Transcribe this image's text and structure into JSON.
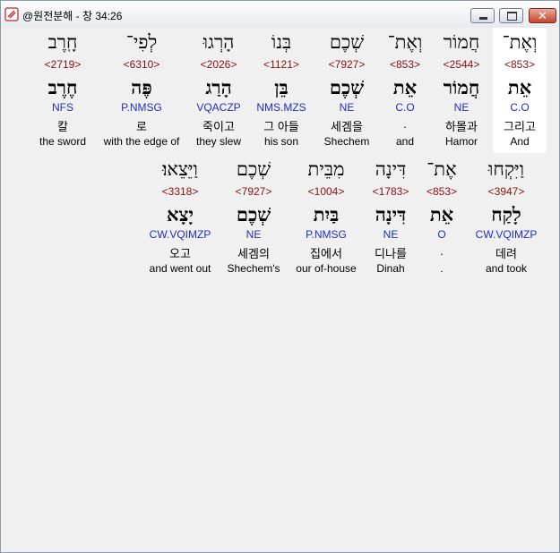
{
  "window": {
    "title": "@원전분해 - 창 34:26",
    "close_glyph": "✕"
  },
  "rows": [
    {
      "words": [
        {
          "heb": "חָֽרֶב",
          "strong": "<2719>",
          "lex": "חֶרֶב",
          "morph": "NFS",
          "kor": "칼",
          "eng": "the sword"
        },
        {
          "heb": "לְפִי־",
          "strong": "<6310>",
          "lex": "פֶּה",
          "morph": "P.NMSG",
          "kor": "로",
          "eng": "with the edge of"
        },
        {
          "heb": "הָרְגוּ",
          "strong": "<2026>",
          "lex": "הָרַג",
          "morph": "VQACZP",
          "kor": "죽이고",
          "eng": "they slew"
        },
        {
          "heb": "בְּנוֹ",
          "strong": "<1121>",
          "lex": "בֵּן",
          "morph": "NMS.MZS",
          "kor": "그 아들",
          "eng": "his son"
        },
        {
          "heb": "שְׁכֶם",
          "strong": "<7927>",
          "lex": "שְׁכֶם",
          "morph": "NE",
          "kor": "세겜을",
          "eng": "Shechem"
        },
        {
          "heb": "וְאֶת־",
          "strong": "<853>",
          "lex": "אֵת",
          "morph": "C.O",
          "kor": ".",
          "eng": "and"
        },
        {
          "heb": "חֲמוֹר",
          "strong": "<2544>",
          "lex": "חֲמוֹר",
          "morph": "NE",
          "kor": "하몰과",
          "eng": "Hamor"
        },
        {
          "heb": "וְאֶת־",
          "strong": "<853>",
          "lex": "אֵת",
          "morph": "C.O",
          "kor": "그리고",
          "eng": "And"
        }
      ]
    },
    {
      "words": [
        {
          "heb": "וַיֵּצֵאוּ׃",
          "strong": "<3318>",
          "lex": "יָצָא",
          "morph": "CW.VQIMZP",
          "kor": "오고",
          "eng": "and went out"
        },
        {
          "heb": "שְׁכֶם",
          "strong": "<7927>",
          "lex": "שְׁכֶם",
          "morph": "NE",
          "kor": "세겜의",
          "eng": "Shechem's"
        },
        {
          "heb": "מִבֵּית",
          "strong": "<1004>",
          "lex": "בַּיִת",
          "morph": "P.NMSG",
          "kor": "집에서",
          "eng": "our of-house"
        },
        {
          "heb": "דִּינָה",
          "strong": "<1783>",
          "lex": "דִּינָה",
          "morph": "NE",
          "kor": "디나를",
          "eng": "Dinah"
        },
        {
          "heb": "אֶת־",
          "strong": "<853>",
          "lex": "אֵת",
          "morph": "O",
          "kor": ".",
          "eng": "."
        },
        {
          "heb": "וַיִּקְחוּ",
          "strong": "<3947>",
          "lex": "לָקַח",
          "morph": "CW.VQIMZP",
          "kor": "데려",
          "eng": "and took"
        }
      ]
    }
  ]
}
